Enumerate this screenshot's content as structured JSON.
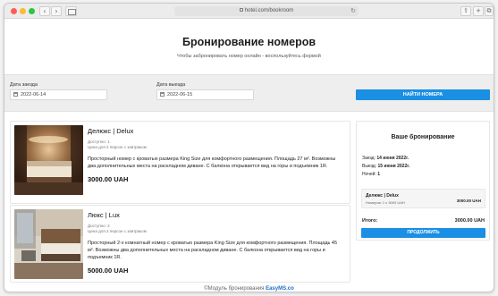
{
  "browser": {
    "back_icon": "chevron-left-icon",
    "forward_icon": "chevron-right-icon",
    "back_glyph": "‹",
    "forward_glyph": "›",
    "address": "hotel.com/bookroom",
    "reload_glyph": "↻",
    "share_glyph": "⇧",
    "plus_glyph": "+",
    "tabs_glyph": "⧉"
  },
  "header": {
    "title": "Бронирование номеров",
    "subtitle": "Чтобы забронировать номер онлайн - воспользуйтесь формой"
  },
  "search": {
    "checkin_label": "Дата заезда",
    "checkin_value": "2022-06-14",
    "checkout_label": "Дата выезда",
    "checkout_value": "2022-06-15",
    "button_label": "НАЙТИ НОМЕРА"
  },
  "rooms": [
    {
      "name": "Делюкс | Delux",
      "available": "Доступно: 1",
      "price_note": "Цена для 2 персон с завтраком",
      "description": "Просторный номер с кроватью размера King Size для комфортного размещения. Площадь 27 м². Возможны два дополнительных места на раскладном диване. С балкона открывается вид на горы и подъемник 1R.",
      "price": "3000.00 UAH"
    },
    {
      "name": "Люкс | Lux",
      "available": "Доступно: 2",
      "price_note": "Цена для 2 персон с завтраком",
      "description": "Просторный 2-х комнатный номер с кроватью размера King Size для комфортного размещения. Площадь 45 м². Возможны два дополнительных места на раскладном диване. С балкона открывается вид на горы и подъемник 1R.",
      "price": "5000.00 UAH"
    }
  ],
  "booking": {
    "title": "Ваше бронирование",
    "checkin_label": "Заезд:",
    "checkin_value": "14 июня 2022г.",
    "checkout_label": "Выезд:",
    "checkout_value": "15 июня 2022г.",
    "nights_label": "Ночей:",
    "nights_value": "1",
    "selected_room_name": "Делюкс | Delux",
    "selected_room_note": "Номеров: 1 x 3000 UAH",
    "selected_room_price": "3000.00 UAH",
    "total_label": "Итого:",
    "total_value": "3000.00 UAH",
    "continue_label": "ПРОДОЛЖИТЬ"
  },
  "footer": {
    "prefix": "©Модуль бронирования",
    "brand": "EasyMS.co"
  },
  "colors": {
    "accent": "#1a8fe3",
    "brand": "#1a6fc9"
  }
}
